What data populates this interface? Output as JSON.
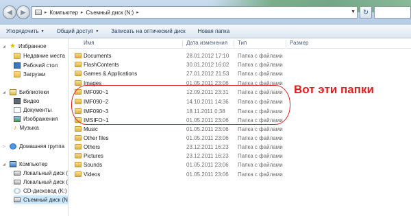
{
  "address_bar": {
    "path": [
      "Компьютер",
      "Съемный диск (N:)"
    ]
  },
  "command_bar": {
    "items": [
      {
        "label": "Упорядочить",
        "has_dropdown": true
      },
      {
        "label": "Общий доступ",
        "has_dropdown": true
      },
      {
        "label": "Записать на оптический диск",
        "has_dropdown": false
      },
      {
        "label": "Новая папка",
        "has_dropdown": false
      }
    ]
  },
  "nav": {
    "favorites": "Избранное",
    "favorites_items": [
      "Недавние места",
      "Рабочий стол",
      "Загрузки"
    ],
    "libraries": "Библиотеки",
    "library_items": [
      "Видео",
      "Документы",
      "Изображения",
      "Музыка"
    ],
    "homegroup": "Домашняя группа",
    "computer": "Компьютер",
    "computer_items": [
      "Локальный диск (",
      "Локальный диск (",
      "CD-дисковод (K:) I",
      "Съемный диск (N:"
    ]
  },
  "columns": {
    "name": "Имя",
    "date": "Дата изменения",
    "type": "Тип",
    "size": "Размер"
  },
  "files": [
    {
      "name": "Documents",
      "date": "28.01.2012 17:10",
      "type": "Папка с файлами"
    },
    {
      "name": "FlashContents",
      "date": "30.01.2012 16:02",
      "type": "Папка с файлами"
    },
    {
      "name": "Games & Applications",
      "date": "27.01.2012 21:53",
      "type": "Папка с файлами"
    },
    {
      "name": "Images",
      "date": "01.05.2011 23:06",
      "type": "Папка с файлами"
    },
    {
      "name": "IMF090~1",
      "date": "12.09.2011 23:31",
      "type": "Папка с файлами"
    },
    {
      "name": "IMF090~2",
      "date": "14.10.2011 14:36",
      "type": "Папка с файлами"
    },
    {
      "name": "IMF090~3",
      "date": "18.11.2011 0:38",
      "type": "Папка с файлами"
    },
    {
      "name": "IMSIFO~1",
      "date": "01.05.2011 23:06",
      "type": "Папка с файлами"
    },
    {
      "name": "Music",
      "date": "01.05.2011 23:06",
      "type": "Папка с файлами"
    },
    {
      "name": "Other files",
      "date": "01.05.2011 23:06",
      "type": "Папка с файлами"
    },
    {
      "name": "Others",
      "date": "23.12.2011 16:23",
      "type": "Папка с файлами"
    },
    {
      "name": "Pictures",
      "date": "23.12.2011 16:23",
      "type": "Папка с файлами"
    },
    {
      "name": "Sounds",
      "date": "01.05.2011 23:06",
      "type": "Папка с файлами"
    },
    {
      "name": "Videos",
      "date": "01.05.2011 23:06",
      "type": "Папка с файлами"
    }
  ],
  "annotation": {
    "text": "Вот эти папки",
    "color": "#e02020"
  }
}
